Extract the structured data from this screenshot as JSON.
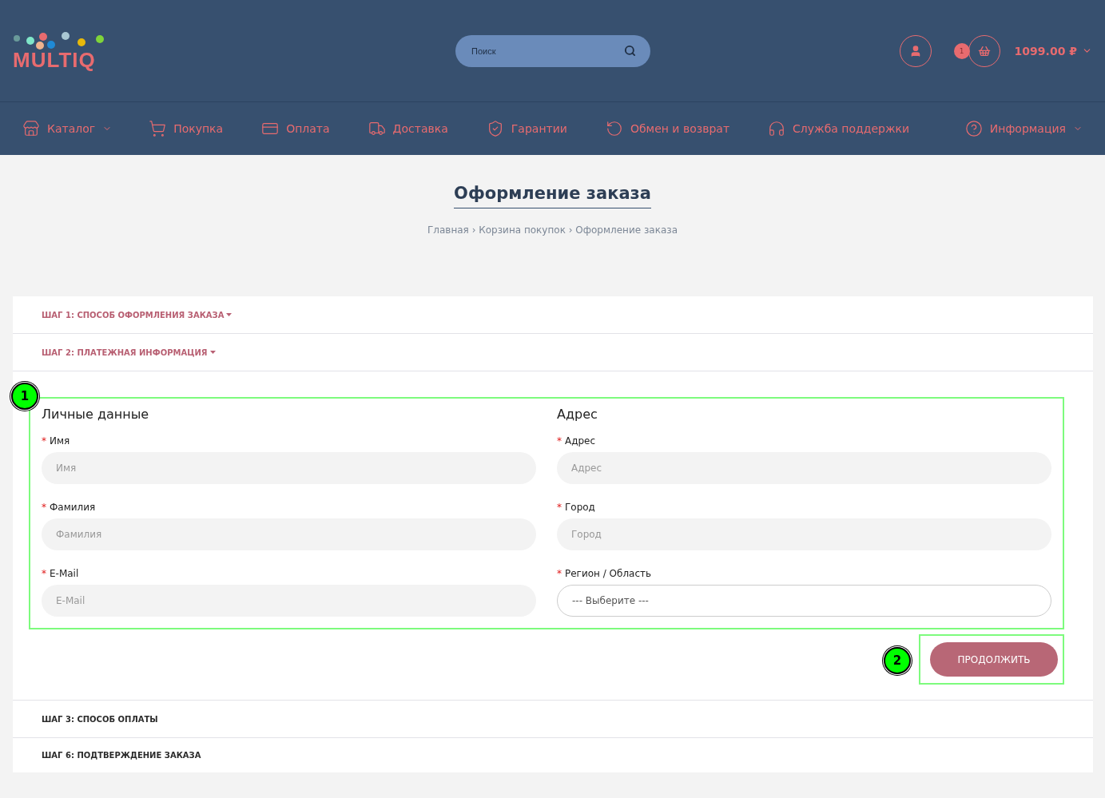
{
  "logo": {
    "text": "MULTIQ"
  },
  "search": {
    "placeholder": "Поиск"
  },
  "cart": {
    "count": "1",
    "total": "1099.00 ₽"
  },
  "nav": [
    {
      "label": "Каталог",
      "dropdown": true
    },
    {
      "label": "Покупка",
      "dropdown": false
    },
    {
      "label": "Оплата",
      "dropdown": false
    },
    {
      "label": "Доставка",
      "dropdown": false
    },
    {
      "label": "Гарантии",
      "dropdown": false
    },
    {
      "label": "Обмен и возврат",
      "dropdown": false
    },
    {
      "label": "Служба поддержки",
      "dropdown": false
    },
    {
      "label": "Информация",
      "dropdown": true
    }
  ],
  "page_title": "Оформление заказа",
  "breadcrumbs": "Главная › Корзина покупок › Оформление заказа",
  "steps_before": [
    {
      "label": "ШАГ 1: СПОСОБ ОФОРМЛЕНИЯ ЗАКАЗА",
      "active": true
    },
    {
      "label": "ШАГ 2: ПЛАТЕЖНАЯ ИНФОРМАЦИЯ",
      "active": true
    }
  ],
  "columns": [
    {
      "title": "Личные данные",
      "fields": [
        {
          "label": "Имя",
          "required_mark": "*",
          "kind": "text",
          "placeholder": "Имя"
        },
        {
          "label": "Фамилия",
          "required_mark": "*",
          "kind": "text",
          "placeholder": "Фамилия"
        },
        {
          "label": "E-Mail",
          "required_mark": "*",
          "kind": "text",
          "placeholder": "E-Mail"
        }
      ]
    },
    {
      "title": "Адрес",
      "fields": [
        {
          "label": "Адрес",
          "required_mark": "*",
          "kind": "text",
          "placeholder": "Адрес"
        },
        {
          "label": "Город",
          "required_mark": "*",
          "kind": "text",
          "placeholder": "Город"
        },
        {
          "label": "Регион / Область",
          "required_mark": "*",
          "kind": "select",
          "value": "--- Выберите ---"
        }
      ]
    }
  ],
  "continue_button": "ПРОДОЛЖИТЬ",
  "annotations": [
    "1",
    "2"
  ],
  "steps_after": [
    {
      "label": "ШАГ 3: СПОСОБ ОПЛАТЫ",
      "active": false
    },
    {
      "label": "ШАГ 6: ПОДТВЕРЖДЕНИЕ ЗАКАЗА",
      "active": false
    }
  ]
}
